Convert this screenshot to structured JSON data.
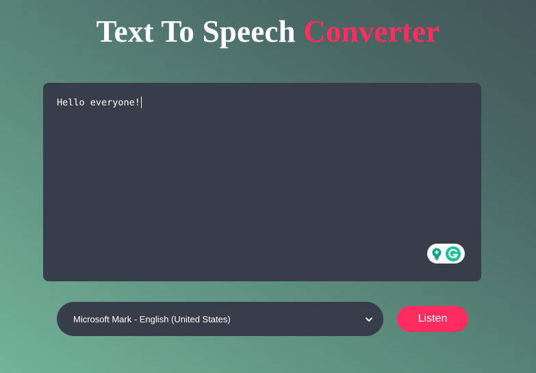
{
  "header": {
    "title_main": "Text To Speech",
    "title_accent": "Converter"
  },
  "editor": {
    "text": "Hello everyone!"
  },
  "grammarly": {
    "icons": [
      "bulb-icon",
      "grammarly-logo-icon"
    ]
  },
  "controls": {
    "voice_selected": "Microsoft Mark - English (United States)",
    "listen_label": "Listen"
  },
  "colors": {
    "accent": "#ff2c60",
    "panel": "#373e49",
    "grammarly_green": "#15c39a"
  }
}
